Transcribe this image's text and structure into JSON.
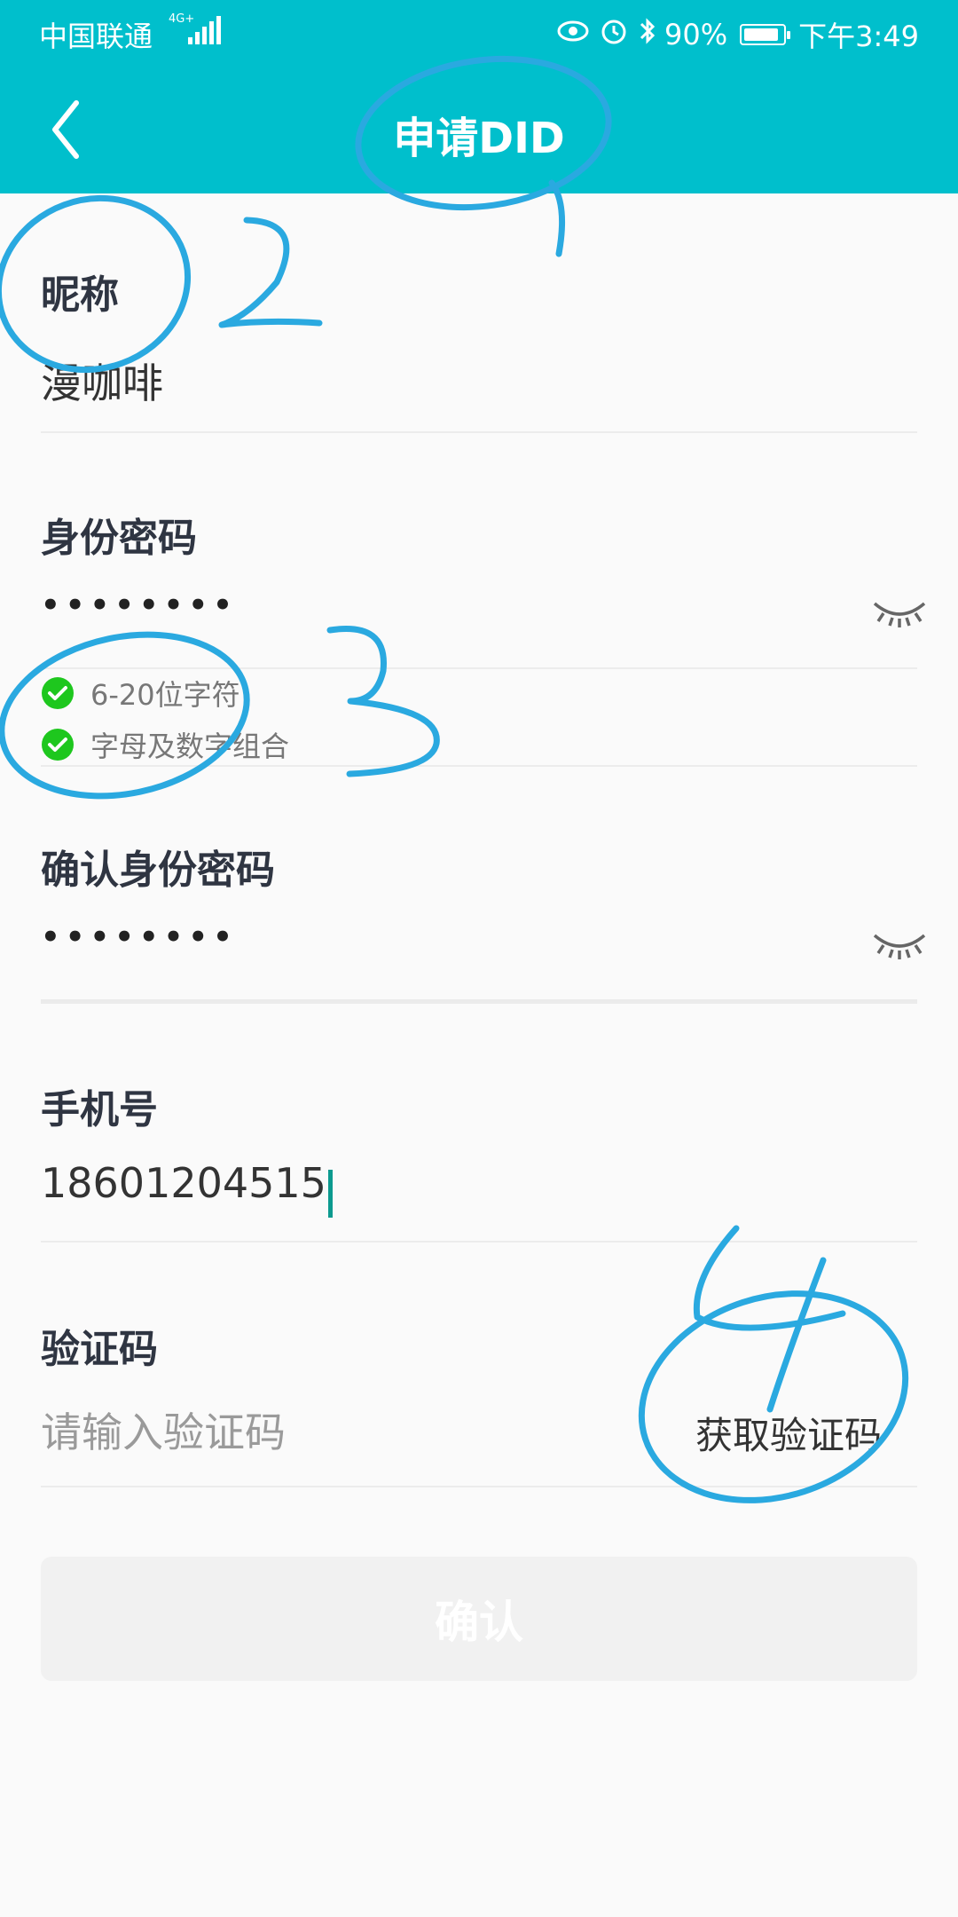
{
  "status_bar": {
    "carrier": "中国联通",
    "network": "4G+",
    "battery": "90%",
    "battery_level": 0.9,
    "time": "下午3:49",
    "icons": [
      "eye-comfort-icon",
      "alarm-icon",
      "bluetooth-icon",
      "battery-icon"
    ]
  },
  "nav": {
    "title": "申请DID",
    "back_icon": "back-chevron-icon"
  },
  "form": {
    "nickname": {
      "label": "昵称",
      "value": "漫咖啡"
    },
    "password": {
      "label": "身份密码",
      "masked": "••••••••"
    },
    "password_rules": [
      {
        "text": "6-20位字符",
        "state": "passed"
      },
      {
        "text": "字母及数字组合",
        "state": "passed"
      }
    ],
    "confirm_password": {
      "label": "确认身份密码",
      "masked": "••••••••"
    },
    "phone": {
      "label": "手机号",
      "value": "18601204515"
    },
    "code": {
      "label": "验证码",
      "placeholder": "请输入验证码",
      "get_code": "获取验证码"
    },
    "submit": "确认"
  },
  "annotation_marks": [
    "1",
    "2",
    "3",
    "4"
  ],
  "colors": {
    "header": "#00bfcc",
    "check": "#1ec71e",
    "annotation": "#2aa9e0",
    "caret": "#0c9a8f"
  }
}
